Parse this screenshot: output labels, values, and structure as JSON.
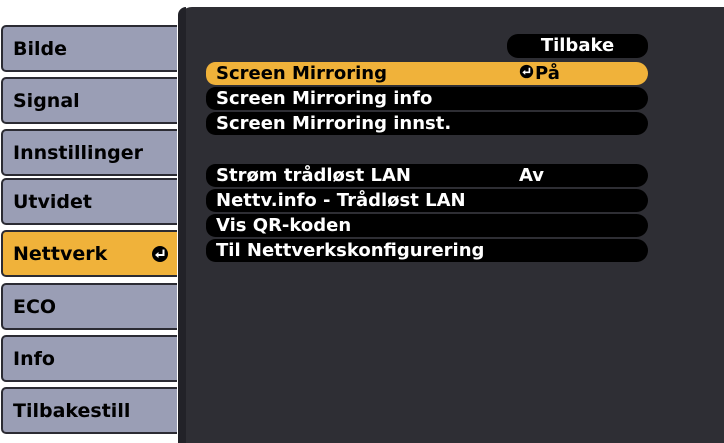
{
  "sidebar": {
    "tabs": [
      {
        "label": "Bilde"
      },
      {
        "label": "Signal"
      },
      {
        "label": "Innstillinger"
      },
      {
        "label": "Utvidet"
      },
      {
        "label": "Nettverk",
        "active": true
      },
      {
        "label": "ECO"
      },
      {
        "label": "Info"
      },
      {
        "label": "Tilbakestill"
      }
    ]
  },
  "main": {
    "back_label": "Tilbake",
    "items": [
      {
        "label": "Screen Mirroring",
        "value": "På",
        "highlighted": true
      },
      {
        "label": "Screen Mirroring info"
      },
      {
        "label": "Screen Mirroring innst."
      },
      {
        "label": "Strøm trådløst LAN",
        "value": "Av"
      },
      {
        "label": "Nettv.info - Trådløst LAN"
      },
      {
        "label": "Vis QR-koden"
      },
      {
        "label": "Til Nettverkskonfigurering"
      }
    ]
  },
  "colors": {
    "panel_bg": "#2e2e34",
    "tab_bg": "#9a9eb5",
    "highlight": "#f0b23a",
    "item_bg": "#000000"
  },
  "icons": {
    "enter": "enter-icon"
  }
}
